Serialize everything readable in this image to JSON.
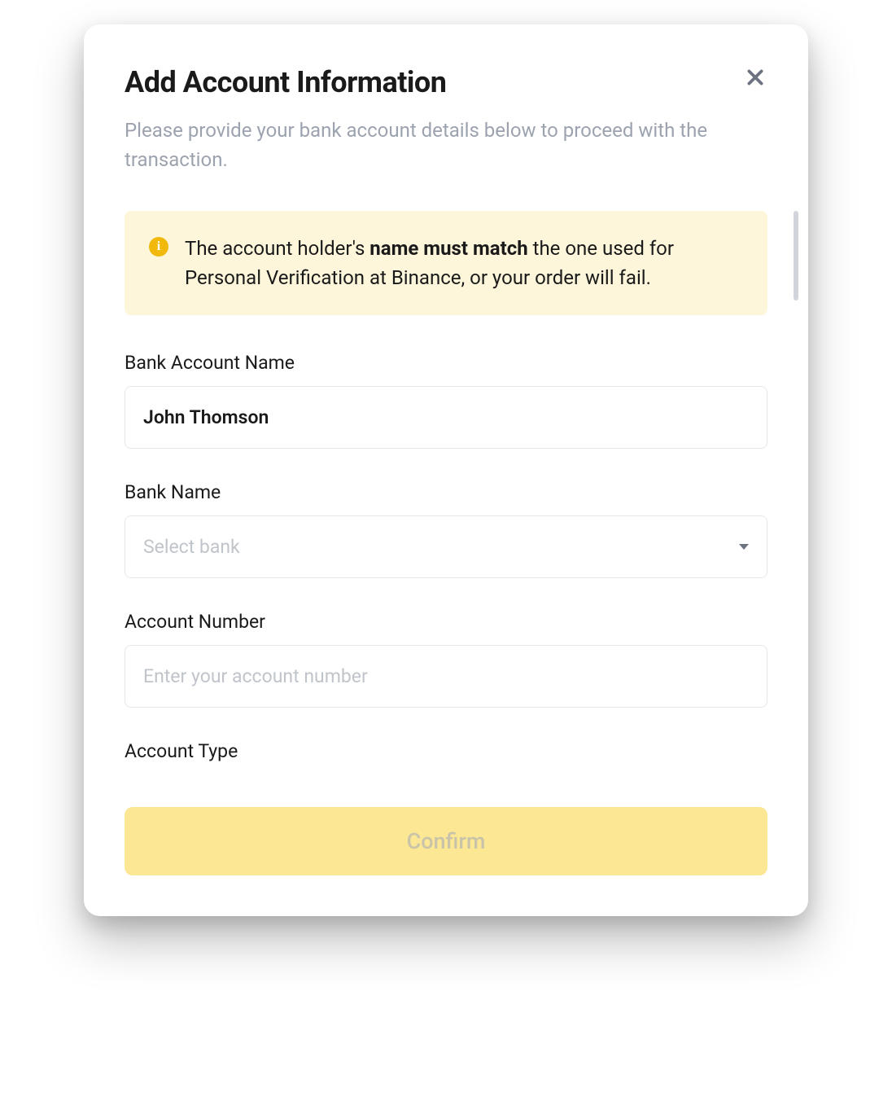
{
  "modal": {
    "title": "Add Account Information",
    "subtitle": "Please provide your bank account details below to proceed with the transaction."
  },
  "warning": {
    "prefix": "The account holder's ",
    "bold": "name must match",
    "suffix": " the one used for Personal Verification at Binance, or your order will fail."
  },
  "form": {
    "bank_account_name": {
      "label": "Bank Account Name",
      "value": "John Thomson"
    },
    "bank_name": {
      "label": "Bank Name",
      "placeholder": "Select bank"
    },
    "account_number": {
      "label": "Account Number",
      "placeholder": "Enter your account number"
    },
    "account_type": {
      "label": "Account Type"
    }
  },
  "actions": {
    "confirm": "Confirm"
  }
}
